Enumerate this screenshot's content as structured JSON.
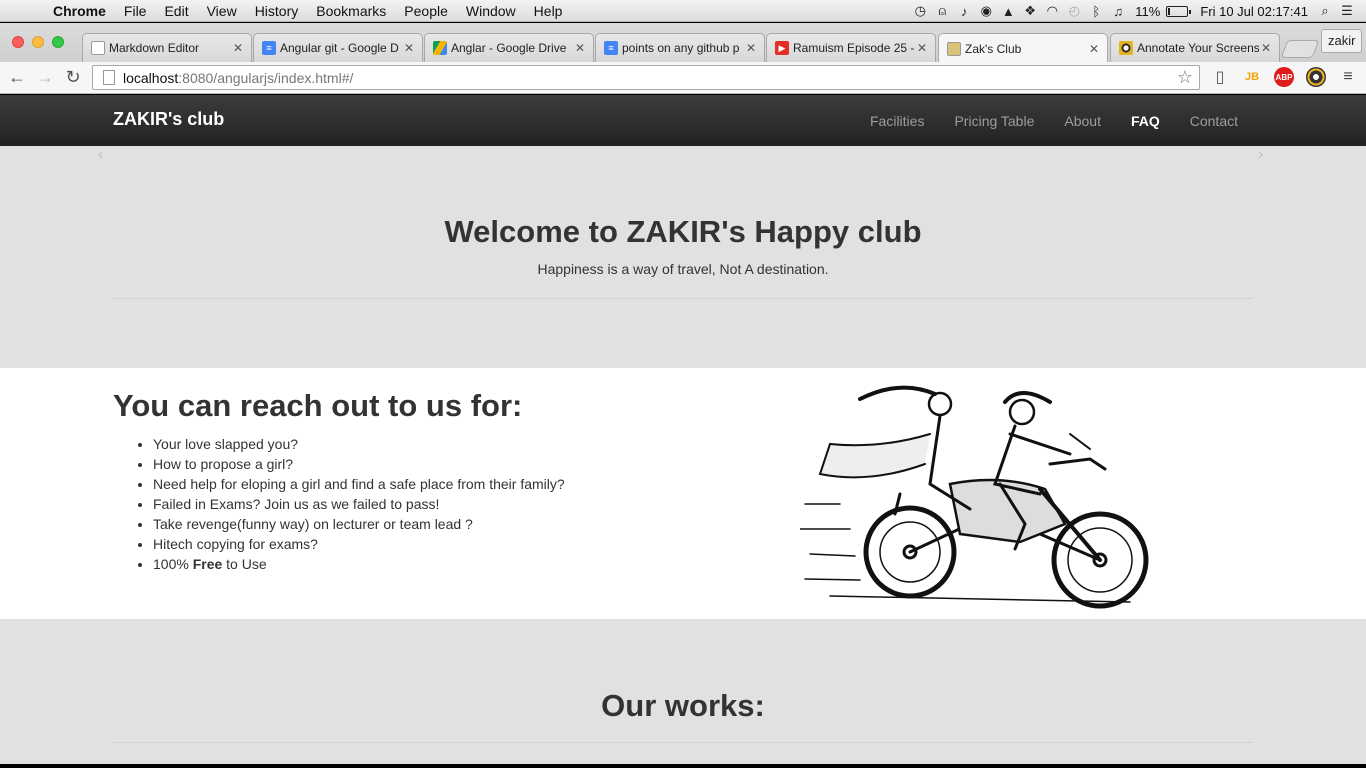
{
  "menubar": {
    "app_name": "Chrome",
    "items": [
      "File",
      "Edit",
      "View",
      "History",
      "Bookmarks",
      "People",
      "Window",
      "Help"
    ],
    "battery_percent": "11%",
    "battery_level": 0.11,
    "clock": "Fri 10 Jul  02:17:41"
  },
  "tabs": [
    {
      "title": "Markdown Editor",
      "icon": "document-icon",
      "color": "#ffffff"
    },
    {
      "title": "Angular git - Google D",
      "icon": "google-docs-icon",
      "color": "#4285f4"
    },
    {
      "title": "Anglar - Google Drive",
      "icon": "google-drive-icon",
      "color": "#0f9d58"
    },
    {
      "title": "points on any github p",
      "icon": "google-docs-icon",
      "color": "#4285f4"
    },
    {
      "title": "Ramuism Episode 25 -",
      "icon": "youtube-icon",
      "color": "#e52d27"
    },
    {
      "title": "Zak's Club",
      "icon": "site-icon",
      "color": "#c9a227"
    },
    {
      "title": "Annotate Your Screens",
      "icon": "annotate-icon",
      "color": "#333333"
    }
  ],
  "profile_name": "zakir",
  "address": {
    "host": "localhost",
    "path": ":8080/angularjs/index.html#/"
  },
  "site": {
    "brand": "ZAKIR's club",
    "nav": [
      "Facilities",
      "Pricing Table",
      "About",
      "FAQ",
      "Contact"
    ],
    "active_nav": "FAQ",
    "hero_title": "Welcome to ZAKIR's Happy club",
    "hero_tagline": "Happiness is a way of travel, Not A destination.",
    "reach_title": "You can reach out to us for:",
    "reach_items": [
      "Your love slapped you?",
      "How to propose a girl?",
      "Need help for eloping a girl and find a safe place from their family?",
      "Failed in Exams? Join us as we failed to pass!",
      "Take revenge(funny way) on lecturer or team lead ?",
      "Hitech copying for exams?"
    ],
    "free_prefix": "100% ",
    "free_bold": "Free",
    "free_suffix": " to Use",
    "works_title": "Our works:"
  },
  "colors": {
    "navbar": "#222222",
    "hero_bg": "#e1e1e1",
    "text": "#333333",
    "nav_link": "#9d9d9d"
  }
}
